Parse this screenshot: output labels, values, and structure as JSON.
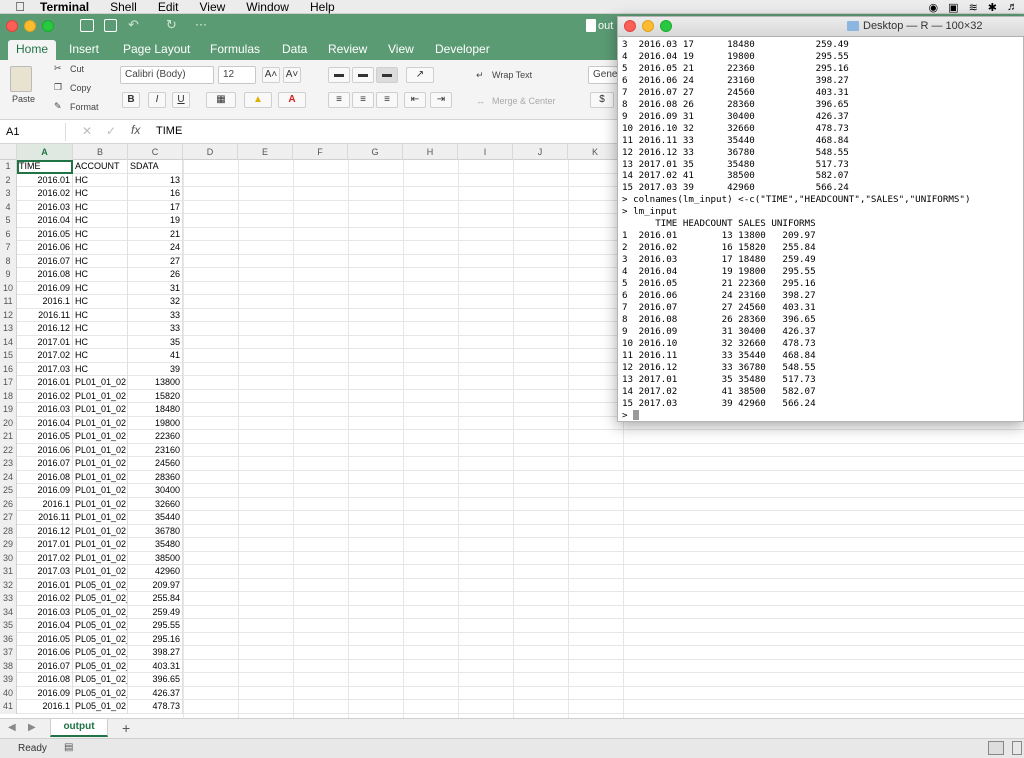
{
  "menubar": {
    "app": "Terminal",
    "items": [
      "Shell",
      "Edit",
      "View",
      "Window",
      "Help"
    ]
  },
  "excel": {
    "tabs": [
      "Home",
      "Insert",
      "Page Layout",
      "Formulas",
      "Data",
      "Review",
      "View",
      "Developer"
    ],
    "active_tab": "Home",
    "title_partial": "out",
    "ribbon": {
      "paste": "Paste",
      "cut": "Cut",
      "copy": "Copy",
      "format": "Format",
      "font_name": "Calibri (Body)",
      "font_size": "12",
      "wrap_text": "Wrap Text",
      "merge_center": "Merge & Center",
      "number_format": "Gene",
      "currency": "$"
    },
    "name_box": "A1",
    "formula_fx": "fx",
    "formula_value": "TIME",
    "columns": [
      "A",
      "B",
      "C",
      "D",
      "E",
      "F",
      "G",
      "H",
      "I",
      "J",
      "K"
    ],
    "rows": [
      [
        "TIME",
        "ACCOUNT",
        "SDATA"
      ],
      [
        "2016.01",
        "HC",
        "13"
      ],
      [
        "2016.02",
        "HC",
        "16"
      ],
      [
        "2016.03",
        "HC",
        "17"
      ],
      [
        "2016.04",
        "HC",
        "19"
      ],
      [
        "2016.05",
        "HC",
        "21"
      ],
      [
        "2016.06",
        "HC",
        "24"
      ],
      [
        "2016.07",
        "HC",
        "27"
      ],
      [
        "2016.08",
        "HC",
        "26"
      ],
      [
        "2016.09",
        "HC",
        "31"
      ],
      [
        "2016.1",
        "HC",
        "32"
      ],
      [
        "2016.11",
        "HC",
        "33"
      ],
      [
        "2016.12",
        "HC",
        "33"
      ],
      [
        "2017.01",
        "HC",
        "35"
      ],
      [
        "2017.02",
        "HC",
        "41"
      ],
      [
        "2017.03",
        "HC",
        "39"
      ],
      [
        "2016.01",
        "PL01_01_02",
        "13800"
      ],
      [
        "2016.02",
        "PL01_01_02",
        "15820"
      ],
      [
        "2016.03",
        "PL01_01_02",
        "18480"
      ],
      [
        "2016.04",
        "PL01_01_02",
        "19800"
      ],
      [
        "2016.05",
        "PL01_01_02",
        "22360"
      ],
      [
        "2016.06",
        "PL01_01_02",
        "23160"
      ],
      [
        "2016.07",
        "PL01_01_02",
        "24560"
      ],
      [
        "2016.08",
        "PL01_01_02",
        "28360"
      ],
      [
        "2016.09",
        "PL01_01_02",
        "30400"
      ],
      [
        "2016.1",
        "PL01_01_02",
        "32660"
      ],
      [
        "2016.11",
        "PL01_01_02",
        "35440"
      ],
      [
        "2016.12",
        "PL01_01_02",
        "36780"
      ],
      [
        "2017.01",
        "PL01_01_02",
        "35480"
      ],
      [
        "2017.02",
        "PL01_01_02",
        "38500"
      ],
      [
        "2017.03",
        "PL01_01_02",
        "42960"
      ],
      [
        "2016.01",
        "PL05_01_02_",
        "209.97"
      ],
      [
        "2016.02",
        "PL05_01_02_",
        "255.84"
      ],
      [
        "2016.03",
        "PL05_01_02_",
        "259.49"
      ],
      [
        "2016.04",
        "PL05_01_02_",
        "295.55"
      ],
      [
        "2016.05",
        "PL05_01_02_",
        "295.16"
      ],
      [
        "2016.06",
        "PL05_01_02_",
        "398.27"
      ],
      [
        "2016.07",
        "PL05_01_02_",
        "403.31"
      ],
      [
        "2016.08",
        "PL05_01_02_",
        "396.65"
      ],
      [
        "2016.09",
        "PL05_01_02_",
        "426.37"
      ],
      [
        "2016.1",
        "PL05_01_02",
        "478.73"
      ]
    ],
    "sheet_tab": "output",
    "status": "Ready"
  },
  "terminal": {
    "title": "Desktop — R — 100×32",
    "lines": [
      "3  2016.03 17      18480           259.49",
      "4  2016.04 19      19800           295.55",
      "5  2016.05 21      22360           295.16",
      "6  2016.06 24      23160           398.27",
      "7  2016.07 27      24560           403.31",
      "8  2016.08 26      28360           396.65",
      "9  2016.09 31      30400           426.37",
      "10 2016.10 32      32660           478.73",
      "11 2016.11 33      35440           468.84",
      "12 2016.12 33      36780           548.55",
      "13 2017.01 35      35480           517.73",
      "14 2017.02 41      38500           582.07",
      "15 2017.03 39      42960           566.24",
      "> colnames(lm_input) <-c(\"TIME\",\"HEADCOUNT\",\"SALES\",\"UNIFORMS\")",
      "> lm_input",
      "      TIME HEADCOUNT SALES UNIFORMS",
      "1  2016.01        13 13800   209.97",
      "2  2016.02        16 15820   255.84",
      "3  2016.03        17 18480   259.49",
      "4  2016.04        19 19800   295.55",
      "5  2016.05        21 22360   295.16",
      "6  2016.06        24 23160   398.27",
      "7  2016.07        27 24560   403.31",
      "8  2016.08        26 28360   396.65",
      "9  2016.09        31 30400   426.37",
      "10 2016.10        32 32660   478.73",
      "11 2016.11        33 35440   468.84",
      "12 2016.12        33 36780   548.55",
      "13 2017.01        35 35480   517.73",
      "14 2017.02        41 38500   582.07",
      "15 2017.03        39 42960   566.24",
      "> "
    ]
  }
}
